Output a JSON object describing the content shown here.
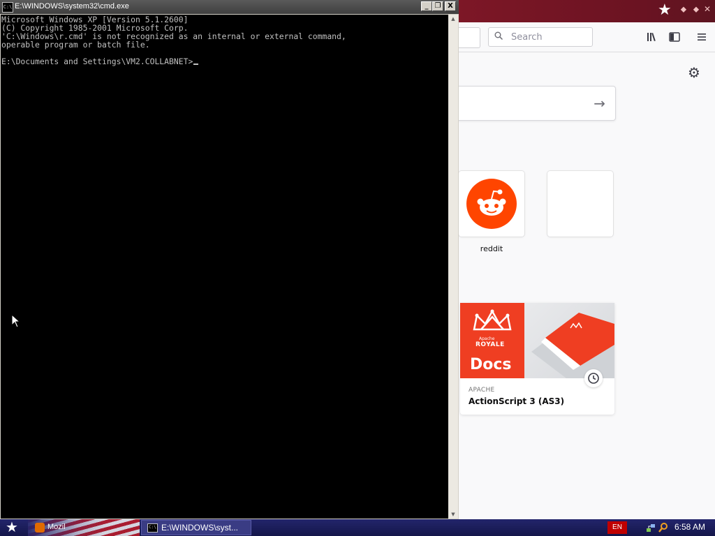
{
  "cmd": {
    "title": "E:\\WINDOWS\\system32\\cmd.exe",
    "icon_label": "C:\\",
    "buttons": {
      "minimize": "_",
      "restore": "❐",
      "close": "X"
    },
    "lines": [
      "Microsoft Windows XP [Version 5.1.2600]",
      "(C) Copyright 1985-2001 Microsoft Corp.",
      "'C:\\Windows\\r.cmd' is not recognized as an internal or external command,",
      "operable program or batch file.",
      "",
      "E:\\Documents and Settings\\VM2.COLLABNET>"
    ]
  },
  "firefox": {
    "search_placeholder": "Search",
    "tiles": [
      {
        "label": "reddit"
      },
      {
        "label": ""
      }
    ],
    "highlight_card": {
      "image_text_small": "Apache",
      "image_text_brand": "ROYALE",
      "image_text_big": "Docs",
      "source": "APACHE",
      "title": "ActionScript 3 (AS3)"
    }
  },
  "taskbar": {
    "task1_label": "Mozil",
    "task2_label": "E:\\WINDOWS\\syst...",
    "task2_icon": "C:\\",
    "lang": "EN",
    "clock": "6:58 AM"
  },
  "icons": {
    "firefox_window": [
      "firefox-star-icon",
      "pin-icon",
      "restore-icon",
      "close-icon"
    ],
    "toolbar": [
      "search-icon",
      "library-icon",
      "sidebar-icon",
      "menu-icon"
    ],
    "newtab": [
      "gear-icon",
      "arrow-right-icon",
      "reddit-icon",
      "clock-icon"
    ]
  },
  "colors": {
    "console_bg": "#000000",
    "console_text": "#c0c0c0",
    "reddit": "#ff4500",
    "royale": "#ef3e22",
    "taskbar": "#1a1b4b"
  }
}
